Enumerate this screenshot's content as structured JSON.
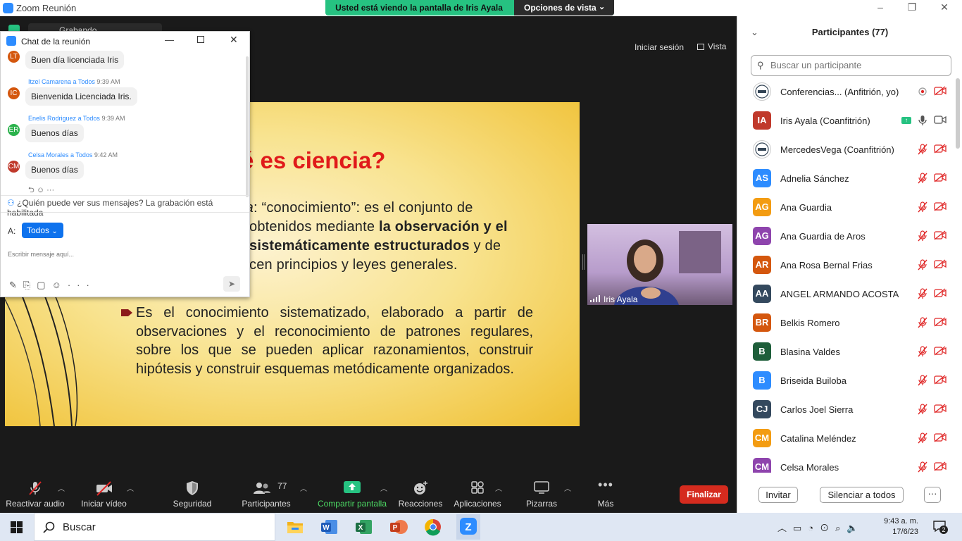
{
  "window": {
    "title": "Zoom Reunión"
  },
  "share_banner": {
    "message": "Usted está viendo la pantalla de Iris Ayala",
    "view_options": "Opciones de vista"
  },
  "meeting": {
    "sign_in": "Iniciar sesión",
    "view": "Vista",
    "recording": "Grabando"
  },
  "slide": {
    "title": "é es ciencia?",
    "line1_italic": "ia",
    "line1": ": “conocimiento”:  es el conjunto de",
    "line2_a": "obtenidos mediante ",
    "line2_b": "la observación y el",
    "line3_b": "sistemáticamente estructurados",
    "line3_c": " y de",
    "line4": "cen principios y leyes generales.",
    "bullet2": "Es el conocimiento sistematizado, elaborado a partir de observaciones y el reconocimiento de patrones regulares, sobre los que se pueden aplicar razonamientos, construir hipótesis y construir esquemas metódicamente organizados."
  },
  "video": {
    "name": "Iris Ayala"
  },
  "chat": {
    "title": "Chat de la reunión",
    "messages": [
      {
        "initials": "LT",
        "color": "#d4570e",
        "sender": "",
        "to": "",
        "time": "",
        "text": "Buen día licenciada Iris"
      },
      {
        "initials": "IC",
        "color": "#d4570e",
        "sender": "Itzel Camarena",
        "to": "a Todos",
        "time": "9:39 AM",
        "text": "Bienvenida Licenciada Iris."
      },
      {
        "initials": "ER",
        "color": "#2bb24c",
        "sender": "Enelis Rodriguez",
        "to": "a Todos",
        "time": "9:39 AM",
        "text": "Buenos días"
      },
      {
        "initials": "CM",
        "color": "#c0392b",
        "sender": "Celsa Morales",
        "to": "a Todos",
        "time": "9:42 AM",
        "text": "Buenos días"
      }
    ],
    "privacy": "¿Quién puede ver sus mensajes? La grabación está habilitada",
    "to_label": "A:",
    "to_value": "Todos",
    "input_placeholder": "Escribir mensaje aquí..."
  },
  "participants": {
    "header": "Participantes (77)",
    "search_placeholder": "Buscar un participante",
    "list": [
      {
        "initials": "",
        "color": "#ffffff",
        "name": "Conferencias... (Anfitrión, yo)",
        "mic": "recording",
        "cam": "off"
      },
      {
        "initials": "IA",
        "color": "#c0392b",
        "name": "Iris Ayala (Coanfitrión)",
        "mic": "on",
        "cam": "on"
      },
      {
        "initials": "",
        "color": "#ffffff",
        "name": "MercedesVega (Coanfitrión)",
        "mic": "off",
        "cam": "off"
      },
      {
        "initials": "AS",
        "color": "#2d8cff",
        "name": "Adnelia Sánchez",
        "mic": "off",
        "cam": "off"
      },
      {
        "initials": "AG",
        "color": "#f39c12",
        "name": "Ana Guardia",
        "mic": "off",
        "cam": "off"
      },
      {
        "initials": "AG",
        "color": "#8e44ad",
        "name": "Ana Guardia de Aros",
        "mic": "off",
        "cam": "off"
      },
      {
        "initials": "AR",
        "color": "#d4570e",
        "name": "Ana Rosa Bernal Frias",
        "mic": "off",
        "cam": "off"
      },
      {
        "initials": "AA",
        "color": "#34495e",
        "name": "ANGEL ARMANDO ACOSTA",
        "mic": "off",
        "cam": "off"
      },
      {
        "initials": "BR",
        "color": "#d4570e",
        "name": "Belkis Romero",
        "mic": "off",
        "cam": "off"
      },
      {
        "initials": "B",
        "color": "#1e5e3a",
        "name": "Blasina Valdes",
        "mic": "off",
        "cam": "off"
      },
      {
        "initials": "B",
        "color": "#2d8cff",
        "name": "Briseida Builoba",
        "mic": "off",
        "cam": "off"
      },
      {
        "initials": "CJ",
        "color": "#34495e",
        "name": "Carlos Joel Sierra",
        "mic": "off",
        "cam": "off"
      },
      {
        "initials": "CM",
        "color": "#f39c12",
        "name": "Catalina Meléndez",
        "mic": "off",
        "cam": "off"
      },
      {
        "initials": "CM",
        "color": "#8e44ad",
        "name": "Celsa Morales",
        "mic": "off",
        "cam": "off"
      }
    ],
    "invite": "Invitar",
    "mute_all": "Silenciar a todos",
    "more": "···"
  },
  "toolbar": {
    "unmute": "Reactivar audio",
    "start_video": "Iniciar vídeo",
    "security": "Seguridad",
    "participants": "Participantes",
    "participants_count": "77",
    "share": "Compartir pantalla",
    "reactions": "Reacciones",
    "apps": "Aplicaciones",
    "whiteboards": "Pizarras",
    "more": "Más",
    "end": "Finalizar"
  },
  "taskbar": {
    "search": "Buscar",
    "time": "9:43 a. m.",
    "date": "17/6/23",
    "notifications": "2"
  }
}
